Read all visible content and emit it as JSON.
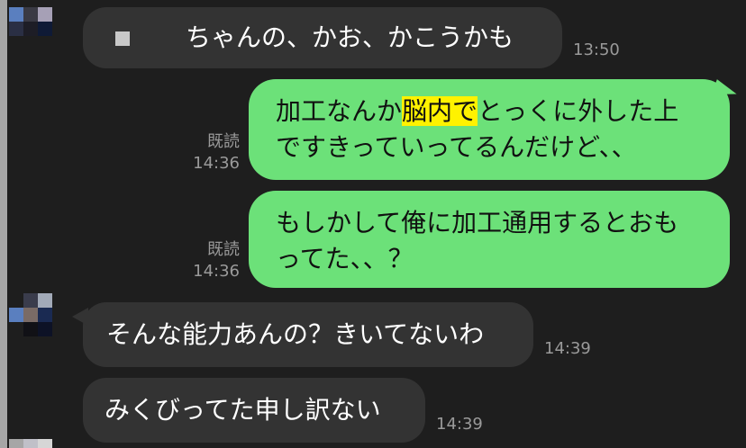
{
  "messages": [
    {
      "side": "in",
      "text": "ちゃんの、かお、かこうかも",
      "time": "13:50"
    },
    {
      "side": "out",
      "text_pre": "加工なんか",
      "text_hl": "脳内で",
      "text_post": "とっくに外した上ですきっていってるんだけど、、",
      "read": "既読",
      "time": "14:36"
    },
    {
      "side": "out",
      "text": "もしかして俺に加工通用するとおもってた、、？",
      "read": "既読",
      "time": "14:36"
    },
    {
      "side": "in",
      "text": "そんな能力あんの？きいてないわ",
      "time": "14:39"
    },
    {
      "side": "in",
      "text": "みくびってた申し訳ない",
      "time": "14:39"
    }
  ],
  "colors": {
    "background": "#1e1e1e",
    "incoming": "#333333",
    "outgoing": "#6ce179",
    "highlight": "#fff200"
  }
}
